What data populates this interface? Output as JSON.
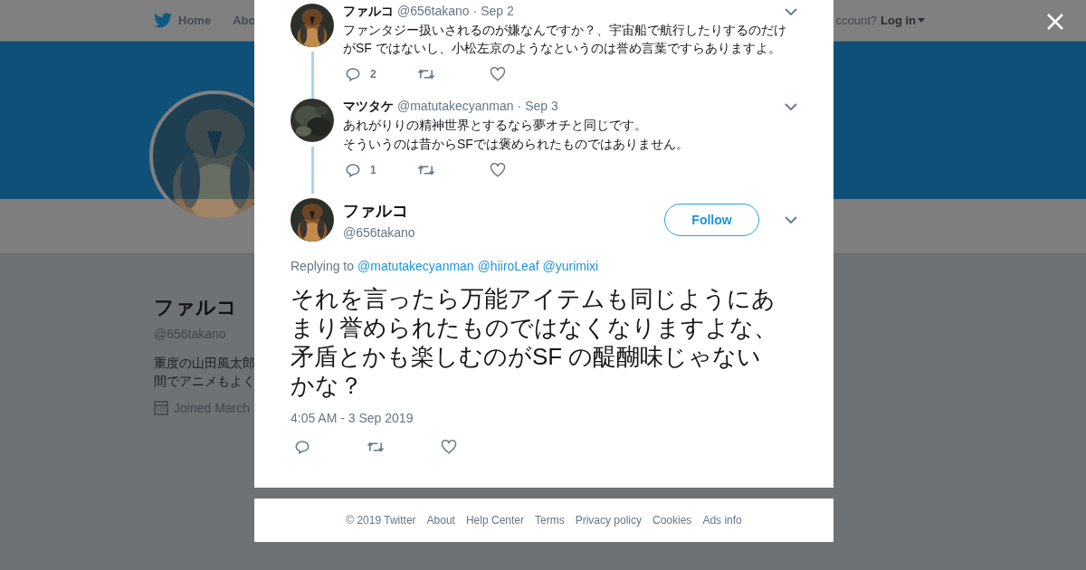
{
  "background_page": {
    "nav": {
      "items": [
        {
          "label": "Home",
          "kind": "home"
        },
        {
          "label": "Abo",
          "kind": "link"
        }
      ],
      "login_prompt": "ccount?",
      "login": "Log in"
    },
    "profile": {
      "name": "ファルコ",
      "handle": "@656takano",
      "bio": [
        "重度の山田風太郎",
        "間でアニメもよく"
      ],
      "joined": "Joined March"
    }
  },
  "thread": [
    {
      "name": "ファルコ",
      "handle": "@656takano",
      "date": "· Sep 2",
      "text": [
        "ファンタジー扱いされるのが嫌なんですか？、宇宙船で航行したりするのだけがSF ではないし、小松左京のようなというのは誉め言葉ですらありますよ。"
      ],
      "replies": "2"
    },
    {
      "name": "マツタケ",
      "handle": "@matutakecyanman",
      "date": "· Sep 3",
      "text": [
        "あれがりりの精神世界とするなら夢オチと同じです。",
        "そういうのは昔からSFでは褒められたものではありません。"
      ],
      "replies": "1"
    }
  ],
  "tweet": {
    "name": "ファルコ",
    "handle": "@656takano",
    "follow": "Follow",
    "replying_label": "Replying to",
    "replying_to": [
      "@matutakecyanman",
      "@hiiroLeaf",
      "@yurimixi"
    ],
    "text": "それを言ったら万能アイテムも同じようにあまり誉められたものではなくなりますよな、矛盾とかも楽しむのがSF の醍醐味じゃないかな？",
    "time": "4:05 AM - 3 Sep 2019"
  },
  "footer": [
    "© 2019 Twitter",
    "About",
    "Help Center",
    "Terms",
    "Privacy policy",
    "Cookies",
    "Ads info"
  ]
}
